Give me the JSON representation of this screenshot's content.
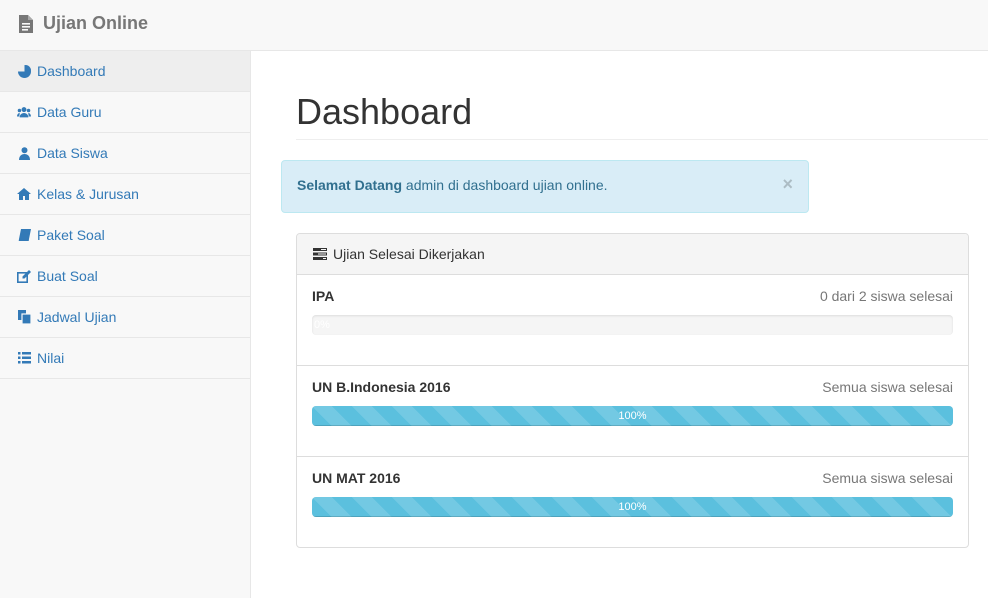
{
  "navbar": {
    "brand": "Ujian Online",
    "brand_icon": "file-icon"
  },
  "sidebar": {
    "items": [
      {
        "label": "Dashboard",
        "icon": "pie-chart-icon",
        "active": true
      },
      {
        "label": "Data Guru",
        "icon": "users-icon"
      },
      {
        "label": "Data Siswa",
        "icon": "user-icon"
      },
      {
        "label": "Kelas & Jurusan",
        "icon": "home-icon"
      },
      {
        "label": "Paket Soal",
        "icon": "book-icon"
      },
      {
        "label": "Buat Soal",
        "icon": "edit-icon"
      },
      {
        "label": "Jadwal Ujian",
        "icon": "copy-icon"
      },
      {
        "label": "Nilai",
        "icon": "list-icon"
      }
    ]
  },
  "main": {
    "title": "Dashboard",
    "alert": {
      "strong": "Selamat Datang",
      "text": " admin di dashboard ujian online.",
      "close": "×"
    },
    "panel": {
      "heading": "Ujian Selesai Dikerjakan",
      "heading_icon": "tasks-icon",
      "items": [
        {
          "name": "IPA",
          "status": "0 dari 2 siswa selesai",
          "progress": 0,
          "progress_label": "0%"
        },
        {
          "name": "UN B.Indonesia 2016",
          "status": "Semua siswa selesai",
          "progress": 100,
          "progress_label": "100%"
        },
        {
          "name": "UN MAT 2016",
          "status": "Semua siswa selesai",
          "progress": 100,
          "progress_label": "100%"
        }
      ]
    }
  },
  "colors": {
    "link": "#337ab7",
    "info_bg": "#d9edf7",
    "info_text": "#31708f",
    "progress_info": "#5bc0de"
  }
}
